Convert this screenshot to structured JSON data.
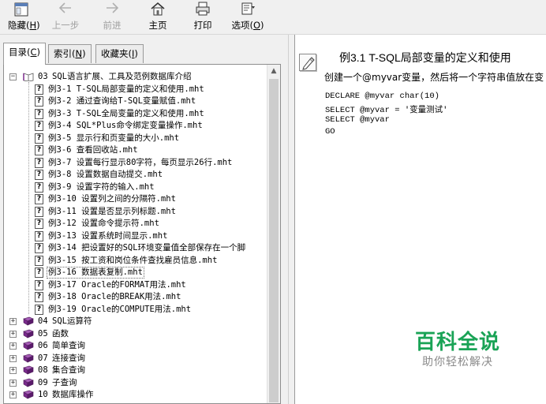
{
  "toolbar": {
    "hide": {
      "label": "隐藏",
      "key": "H",
      "icon": "hide-pane-icon"
    },
    "back": {
      "label": "上一步",
      "icon": "arrow-left-icon",
      "disabled": true
    },
    "forward": {
      "label": "前进",
      "icon": "arrow-right-icon",
      "disabled": true
    },
    "home": {
      "label": "主页",
      "icon": "home-icon"
    },
    "print": {
      "label": "打印",
      "icon": "printer-icon"
    },
    "options": {
      "label": "选项",
      "key": "O",
      "icon": "options-icon"
    }
  },
  "tabs": [
    {
      "label": "目录",
      "key": "C",
      "active": true
    },
    {
      "label": "索引",
      "key": "N",
      "active": false
    },
    {
      "label": "收藏夹",
      "key": "I",
      "active": false
    }
  ],
  "tree": {
    "open_chapter": {
      "num": "03",
      "title": "SQL语言扩展、工具及范例数据库介绍"
    },
    "topics": [
      "例3-1 T-SQL局部变量的定义和使用.mht",
      "例3-2 通过查询给T-SQL变量赋值.mht",
      "例3-3 T-SQL全局变量的定义和使用.mht",
      "例3-4 SQL*Plus命令绑定变量操作.mht",
      "例3-5 显示行和页变量的大小.mht",
      "例3-6 查看回收站.mht",
      "例3-7 设置每行显示80字符，每页显示26行.mht",
      "例3-8 设置数据自动提交.mht",
      "例3-9 设置字符的输入.mht",
      "例3-10 设置列之间的分隔符.mht",
      "例3-11 设置是否显示列标题.mht",
      "例3-12 设置命令提示符.mht",
      "例3-13 设置系统时间显示.mht",
      "例3-14 把设置好的SQL环境变量值全部保存在一个脚",
      "例3-15 按工资和岗位条件查找雇员信息.mht",
      "例3-16 数据表复制.mht",
      "例3-17 Oracle的FORMAT用法.mht",
      "例3-18 Oracle的BREAK用法.mht",
      "例3-19 Oracle的COMPUTE用法.mht"
    ],
    "selected_index": 15,
    "closed_chapters": [
      {
        "num": "04",
        "title": "SQL运算符"
      },
      {
        "num": "05",
        "title": "函数"
      },
      {
        "num": "06",
        "title": "简单查询"
      },
      {
        "num": "07",
        "title": "连接查询"
      },
      {
        "num": "08",
        "title": "集合查询"
      },
      {
        "num": "09",
        "title": "子查询"
      },
      {
        "num": "10",
        "title": "数据库操作"
      }
    ]
  },
  "content": {
    "title": "例3.1  T-SQL局部变量的定义和使用",
    "intro": "创建一个@myvar变量，然后将一个字符串值放在变",
    "code": [
      "DECLARE @myvar  char(10)",
      "SELECT  @myvar = '变量测试'",
      "SELECT @myvar",
      "GO"
    ]
  },
  "watermark": {
    "main": "百科全说",
    "sub": "助你轻松解决"
  },
  "colors": {
    "watermark_green": "#1aa356",
    "book_purple": "#7a2a8c"
  }
}
